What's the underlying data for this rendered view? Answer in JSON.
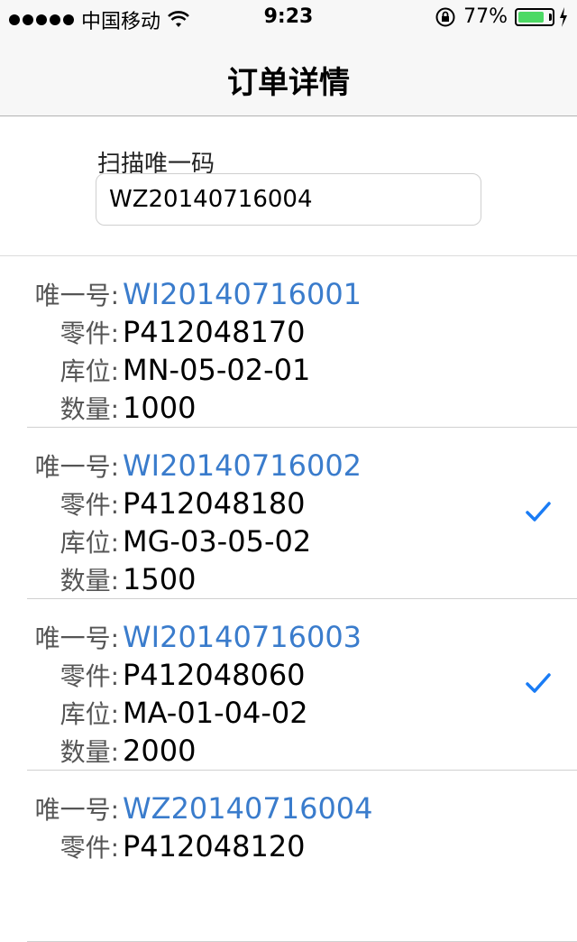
{
  "status_bar": {
    "carrier": "中国移动",
    "time": "9:23",
    "battery_percent": "77%",
    "battery_level": 0.77,
    "icons": [
      "signal-dots-icon",
      "wifi-icon",
      "rotation-lock-icon",
      "battery-icon",
      "charging-icon"
    ]
  },
  "nav": {
    "title": "订单详情"
  },
  "scan": {
    "label": "扫描唯一码",
    "value": "WZ20140716004"
  },
  "labels": {
    "unique": "唯一号:",
    "part": "零件:",
    "location": "库位:",
    "quantity": "数量:"
  },
  "items": [
    {
      "unique": "WI20140716001",
      "part": "P412048170",
      "location": "MN-05-02-01",
      "quantity": "1000",
      "checked": false
    },
    {
      "unique": "WI20140716002",
      "part": "P412048180",
      "location": "MG-03-05-02",
      "quantity": "1500",
      "checked": true
    },
    {
      "unique": "WI20140716003",
      "part": "P412048060",
      "location": "MA-01-04-02",
      "quantity": "2000",
      "checked": true
    },
    {
      "unique": "WZ20140716004",
      "part": "P412048120",
      "location": "",
      "quantity": "",
      "checked": false
    }
  ],
  "colors": {
    "link": "#3a7ccc",
    "check": "#1a7cf5",
    "battery": "#4cd964"
  }
}
